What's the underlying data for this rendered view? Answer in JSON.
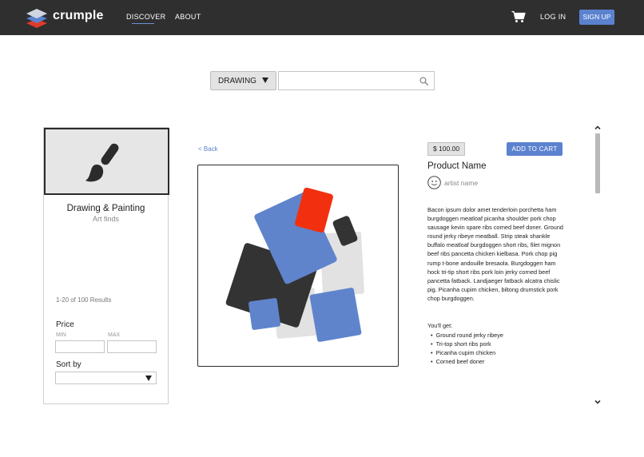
{
  "brand": {
    "name": "crumple",
    "logo_icon": "layered-stack-logo"
  },
  "nav": {
    "discover": "DISCOVER",
    "about": "ABOUT",
    "login": "LOG IN",
    "signup": "SIGN UP",
    "cart_icon": "shopping-cart-icon"
  },
  "search": {
    "category": "DRAWING",
    "value": "",
    "placeholder": "",
    "icon": "search-icon"
  },
  "sidebar": {
    "category_icon": "paintbrush-icon",
    "category_title": "Drawing & Painting",
    "category_subtitle": "Art finds",
    "results": "1-20 of 100 Results",
    "price_label": "Price",
    "min_label": "MIN",
    "max_label": "MAX",
    "min_value": "",
    "max_value": "",
    "sort_label": "Sort by",
    "sort_value": ""
  },
  "product": {
    "back": "< Back",
    "price": "$ 100.00",
    "add_to_cart": "ADD TO CART",
    "name": "Product Name",
    "artist": "artist name",
    "description": "Bacon ipsum dolor amet tenderloin porchetta ham burgdoggen meatloaf picanha shoulder pork chop sausage kevin spare ribs corned beef doner. Ground round jerky ribeye meatball. Strip steak shankle buffalo meatloaf burgdoggen short ribs, filet mignon beef ribs pancetta chicken kielbasa. Pork chop pig rump t-bone andouille bresaola. Burgdoggen ham hock tri-tip short ribs pork loin jerky corned beef pancetta fatback. Landjaeger fatback alcatra chislic pig. Picanha cupim chicken, biltong drumstick pork chop burgdoggen.",
    "youll_get": "You'll get:",
    "features": [
      "Ground round jerky ribeye",
      "Tri-top short ribs pork",
      "Picanha cupim chicken",
      "Corned beef doner"
    ]
  },
  "colors": {
    "header_bg": "#2f2f2f",
    "accent": "#5b82cf",
    "art_blue": "#5f84cc",
    "art_red": "#f2300f",
    "art_dark": "#333333",
    "art_gray": "#e2e2e2"
  }
}
